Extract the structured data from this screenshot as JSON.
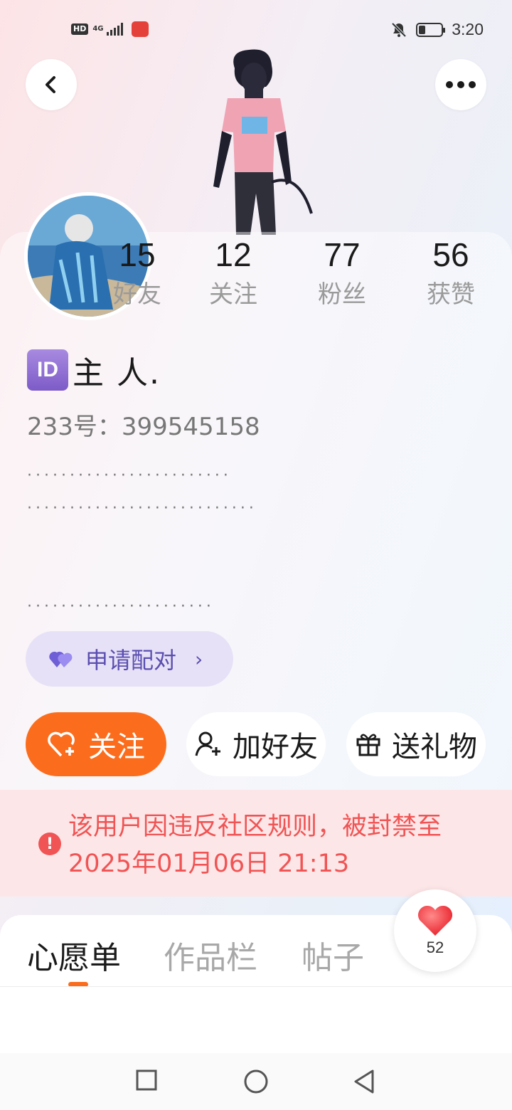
{
  "status_bar": {
    "hd": "HD",
    "network": "4G",
    "time": "3:20",
    "battery_level": 0.3
  },
  "header": {
    "back_icon": "chevron-left-icon",
    "more_icon": "more-dots-icon"
  },
  "profile": {
    "stats": [
      {
        "value": "15",
        "label": "好友"
      },
      {
        "value": "12",
        "label": "关注"
      },
      {
        "value": "77",
        "label": "粉丝"
      },
      {
        "value": "56",
        "label": "获赞"
      }
    ],
    "id_badge": "ID",
    "username": "主 人.",
    "uid_line": "233号：399545158",
    "bio_lines": [
      "························",
      "···························",
      "",
      "",
      "······················"
    ]
  },
  "pair_button": {
    "label": "申请配对",
    "arrow": "›"
  },
  "actions": {
    "follow_label": "关注",
    "add_friend_label": "加好友",
    "gift_label": "送礼物"
  },
  "ban_notice": {
    "icon": "!",
    "text": "该用户因违反社区规则，被封禁至2025年01月06日 21:13"
  },
  "tabs": [
    {
      "label": "心愿单",
      "active": true
    },
    {
      "label": "作品栏",
      "active": false
    },
    {
      "label": "帖子",
      "active": false
    }
  ],
  "like_button": {
    "count": "52"
  },
  "colors": {
    "accent_orange": "#fb6d1c",
    "ban_red": "#f05454",
    "pair_purple": "#5a4fb0"
  }
}
